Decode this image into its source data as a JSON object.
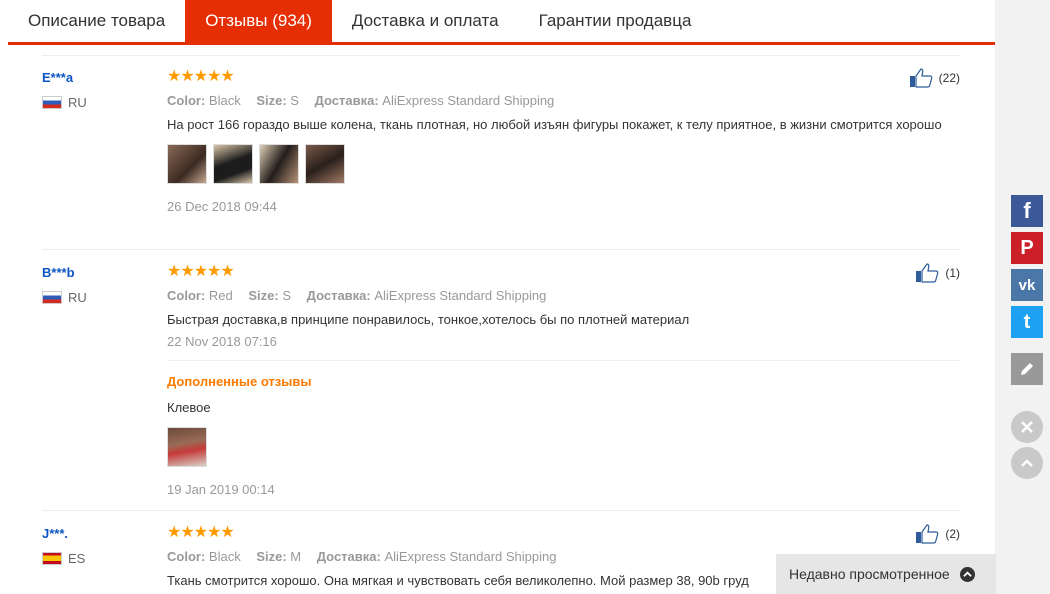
{
  "tabs": [
    {
      "label": "Описание товара",
      "active": false
    },
    {
      "label": "Отзывы (934)",
      "active": true
    },
    {
      "label": "Доставка и оплата",
      "active": false
    },
    {
      "label": "Гарантии продавца",
      "active": false
    }
  ],
  "labels": {
    "color": "Color:",
    "size": "Size:",
    "delivery": "Доставка:"
  },
  "reviews": [
    {
      "user": "E***a",
      "country": "RU",
      "stars": "★★★★★",
      "rating": 5,
      "color": "Black",
      "size": "S",
      "delivery": "AliExpress Standard Shipping",
      "text": "На рост 166 гораздо выше колена, ткань плотная, но любой изъян фигуры покажет, к телу приятное, в жизни смотрится хорошо",
      "date": "26 Dec 2018 09:44",
      "likes": "(22)"
    },
    {
      "user": "B***b",
      "country": "RU",
      "stars": "★★★★★",
      "rating": 5,
      "color": "Red",
      "size": "S",
      "delivery": "AliExpress Standard Shipping",
      "text": "Быстрая доставка,в принципе понравилось, тонкое,хотелось бы по плотней материал",
      "date": "22 Nov 2018 07:16",
      "likes": "(1)",
      "additional": {
        "title": "Дополненные отзывы",
        "text": "Клевое",
        "date": "19 Jan 2019 00:14"
      }
    },
    {
      "user": "J***.",
      "country": "ES",
      "stars": "★★★★★",
      "rating": 5,
      "color": "Black",
      "size": "M",
      "delivery": "AliExpress Standard Shipping",
      "text": "Ткань смотрится хорошо. Она мягкая и чувствовать себя великолепно. Мой размер 38, 90b груд",
      "likes": "(2)"
    }
  ],
  "share": {
    "facebook": "f",
    "pinterest": "P",
    "vk": "vk",
    "twitter": "t"
  },
  "recently_viewed": "Недавно просмотренное",
  "colors": {
    "accent": "#e62e04",
    "stars": "#ff9a00",
    "username": "#0d56c4",
    "additional_title": "#ff7a00"
  }
}
